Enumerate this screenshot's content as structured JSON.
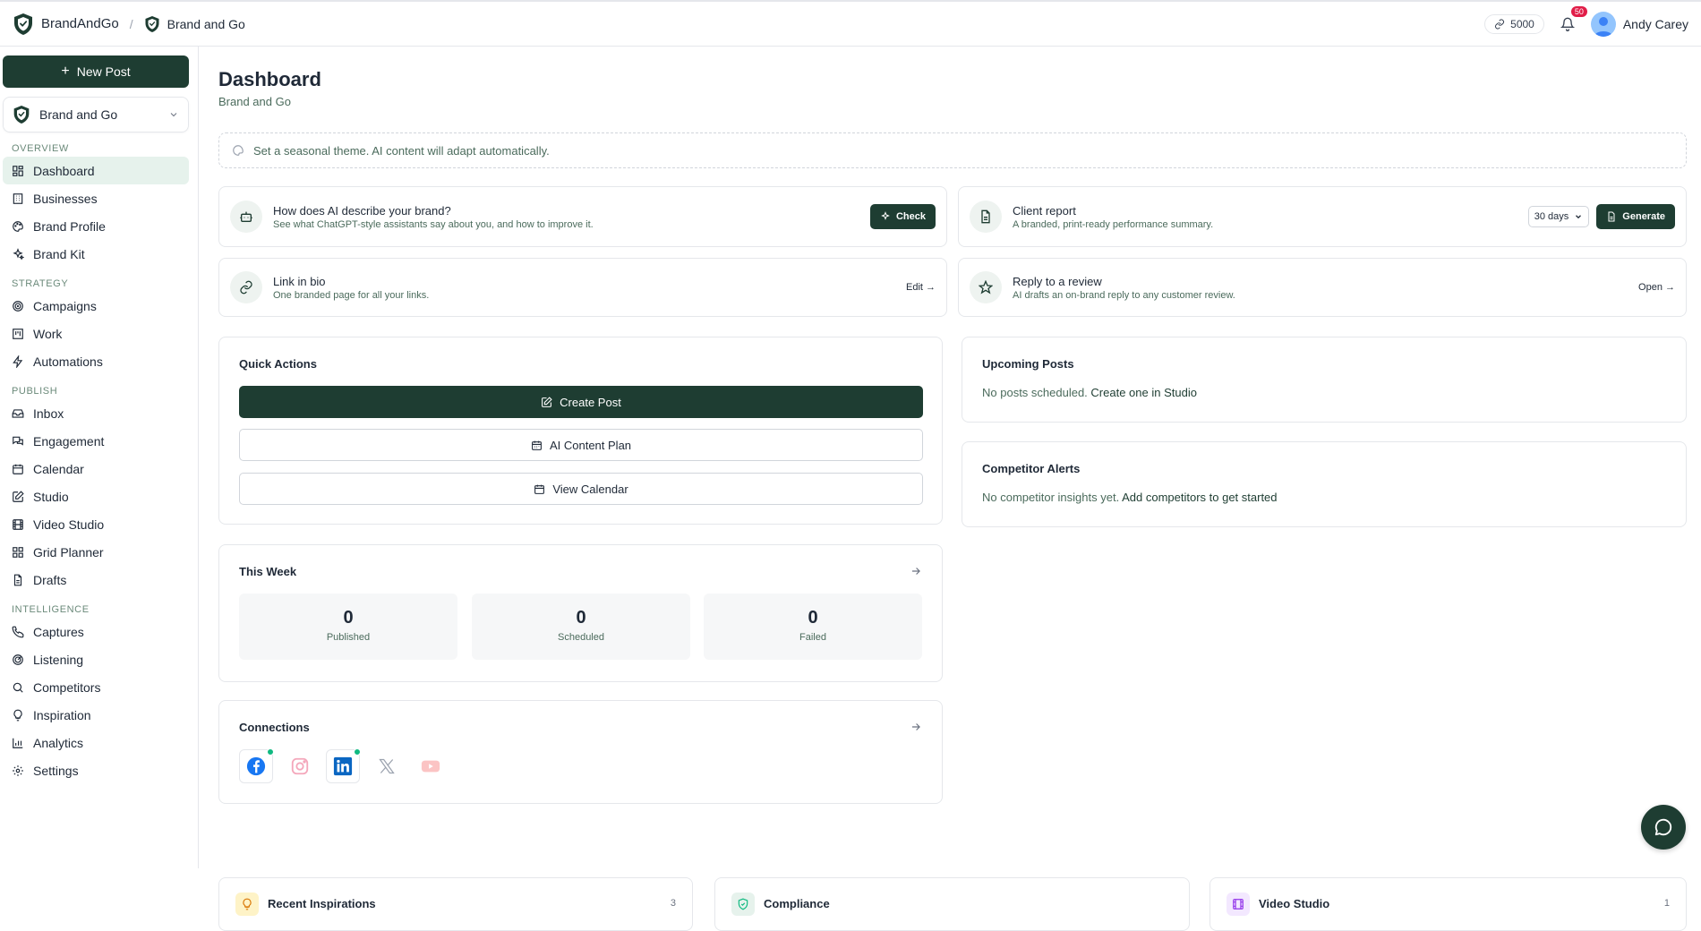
{
  "header": {
    "brand_name": "BrandAndGo",
    "breadcrumb_separator": "/",
    "breadcrumb_current": "Brand and Go",
    "credits": "5000",
    "notifications_count": "50",
    "user_name": "Andy Carey"
  },
  "sidebar": {
    "new_post_label": "New Post",
    "business_selector": "Brand and Go",
    "sections": {
      "overview": "OVERVIEW",
      "strategy": "STRATEGY",
      "publish": "PUBLISH",
      "intelligence": "INTELLIGENCE"
    },
    "items": {
      "dashboard": "Dashboard",
      "businesses": "Businesses",
      "brand_profile": "Brand Profile",
      "brand_kit": "Brand Kit",
      "campaigns": "Campaigns",
      "work": "Work",
      "automations": "Automations",
      "inbox": "Inbox",
      "engagement": "Engagement",
      "calendar": "Calendar",
      "studio": "Studio",
      "video_studio": "Video Studio",
      "grid_planner": "Grid Planner",
      "drafts": "Drafts",
      "captures": "Captures",
      "listening": "Listening",
      "competitors": "Competitors",
      "inspiration": "Inspiration",
      "analytics": "Analytics",
      "settings": "Settings"
    }
  },
  "main": {
    "title": "Dashboard",
    "subtitle": "Brand and Go",
    "theme_hint": "Set a seasonal theme. AI content will adapt automatically.",
    "features": {
      "ai_describe": {
        "title": "How does AI describe your brand?",
        "desc": "See what ChatGPT-style assistants say about you, and how to improve it.",
        "action": "Check"
      },
      "client_report": {
        "title": "Client report",
        "desc": "A branded, print-ready performance summary.",
        "range": "30 days",
        "action": "Generate"
      },
      "link_in_bio": {
        "title": "Link in bio",
        "desc": "One branded page for all your links.",
        "action": "Edit →"
      },
      "reply_review": {
        "title": "Reply to a review",
        "desc": "AI drafts an on-brand reply to any customer review.",
        "action": "Open →"
      }
    },
    "quick_actions": {
      "title": "Quick Actions",
      "create_post": "Create Post",
      "ai_content_plan": "AI Content Plan",
      "view_calendar": "View Calendar"
    },
    "upcoming_posts": {
      "title": "Upcoming Posts",
      "empty": "No posts scheduled.",
      "link": "Create one in Studio"
    },
    "competitor_alerts": {
      "title": "Competitor Alerts",
      "empty": "No competitor insights yet.",
      "link": "Add competitors to get started"
    },
    "this_week": {
      "title": "This Week",
      "stats": [
        {
          "value": "0",
          "label": "Published"
        },
        {
          "value": "0",
          "label": "Scheduled"
        },
        {
          "value": "0",
          "label": "Failed"
        }
      ]
    },
    "connections": {
      "title": "Connections",
      "platforms": [
        {
          "icon": "facebook-icon",
          "connected": true
        },
        {
          "icon": "instagram-icon",
          "connected": false
        },
        {
          "icon": "linkedin-icon",
          "connected": true
        },
        {
          "icon": "x-icon",
          "connected": false
        },
        {
          "icon": "youtube-icon",
          "connected": false
        }
      ]
    },
    "bottom_cards": {
      "recent_inspirations": {
        "title": "Recent Inspirations",
        "count": "3"
      },
      "compliance": {
        "title": "Compliance"
      },
      "video_studio": {
        "title": "Video Studio",
        "count": "1"
      }
    }
  },
  "colors": {
    "brand_dark": "#1e3d32",
    "active_nav_bg": "#e6f2ec",
    "badge_red": "#e11d48",
    "connected_dot": "#10b981"
  }
}
